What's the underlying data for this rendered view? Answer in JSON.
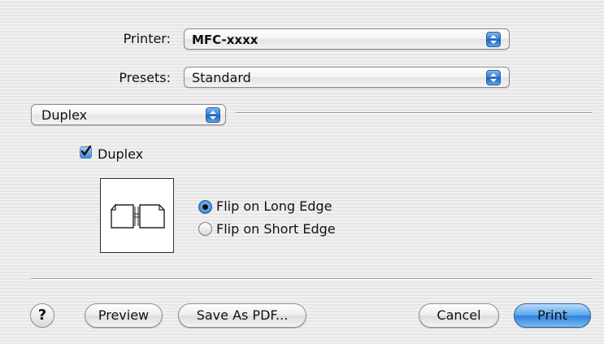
{
  "printer": {
    "label": "Printer:",
    "value": "MFC-xxxx"
  },
  "presets": {
    "label": "Presets:",
    "value": "Standard"
  },
  "panel": {
    "value": "Duplex"
  },
  "duplex": {
    "checkbox_label": "Duplex",
    "checked": true,
    "options": [
      {
        "label": "Flip on Long Edge",
        "selected": true
      },
      {
        "label": "Flip on Short Edge",
        "selected": false
      }
    ]
  },
  "buttons": {
    "help": "?",
    "preview": "Preview",
    "save_pdf": "Save As PDF...",
    "cancel": "Cancel",
    "print": "Print"
  },
  "colors": {
    "accent": "#2f7fdb",
    "background": "#ececec"
  },
  "icons": {
    "duplex_preview": "duplex-long-edge-icon",
    "popup_arrows": "updown-arrows-icon"
  }
}
